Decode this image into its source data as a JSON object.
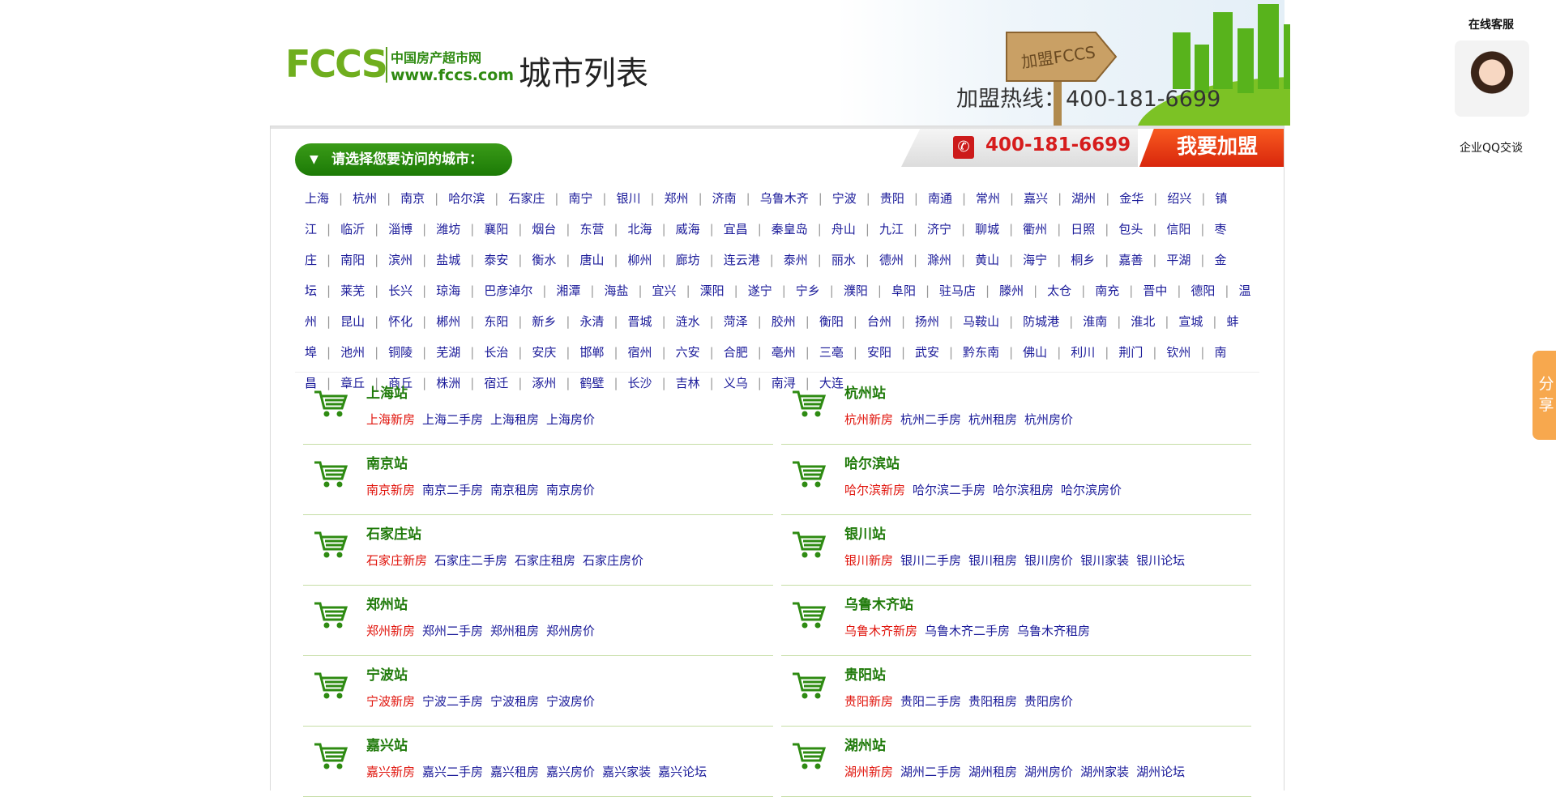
{
  "header": {
    "logo_cn": "中国房产超市网",
    "logo_url": "www.fccs.com",
    "logo_mark": "FCCS",
    "page_title": "城市列表",
    "sign_text": "加盟FCCS",
    "join_hotline": "加盟热线：400-181-6699"
  },
  "panel": {
    "select_prompt": "请选择您要访问的城市：",
    "hotline": "400-181-6699",
    "join_button": "我要加盟"
  },
  "cities": [
    "上海",
    "杭州",
    "南京",
    "哈尔滨",
    "石家庄",
    "南宁",
    "银川",
    "郑州",
    "济南",
    "乌鲁木齐",
    "宁波",
    "贵阳",
    "南通",
    "常州",
    "嘉兴",
    "湖州",
    "金华",
    "绍兴",
    "镇江",
    "临沂",
    "淄博",
    "潍坊",
    "襄阳",
    "烟台",
    "东营",
    "北海",
    "威海",
    "宜昌",
    "秦皇岛",
    "舟山",
    "九江",
    "济宁",
    "聊城",
    "衢州",
    "日照",
    "包头",
    "信阳",
    "枣庄",
    "南阳",
    "滨州",
    "盐城",
    "泰安",
    "衡水",
    "唐山",
    "柳州",
    "廊坊",
    "连云港",
    "泰州",
    "丽水",
    "德州",
    "滁州",
    "黄山",
    "海宁",
    "桐乡",
    "嘉善",
    "平湖",
    "金坛",
    "莱芜",
    "长兴",
    "琼海",
    "巴彦淖尔",
    "湘潭",
    "海盐",
    "宜兴",
    "溧阳",
    "遂宁",
    "宁乡",
    "濮阳",
    "阜阳",
    "驻马店",
    "滕州",
    "太仓",
    "南充",
    "晋中",
    "德阳",
    "温州",
    "昆山",
    "怀化",
    "郴州",
    "东阳",
    "新乡",
    "永清",
    "晋城",
    "涟水",
    "菏泽",
    "胶州",
    "衡阳",
    "台州",
    "扬州",
    "马鞍山",
    "防城港",
    "淮南",
    "淮北",
    "宣城",
    "蚌埠",
    "池州",
    "铜陵",
    "芜湖",
    "长治",
    "安庆",
    "邯郸",
    "宿州",
    "六安",
    "合肥",
    "亳州",
    "三亳",
    "安阳",
    "武安",
    "黔东南",
    "佛山",
    "利川",
    "荆门",
    "钦州",
    "南昌",
    "章丘",
    "商丘",
    "株洲",
    "宿迁",
    "涿州",
    "鹤壁",
    "长沙",
    "吉林",
    "义乌",
    "南浔",
    "大连"
  ],
  "city_lines": [
    {
      "start": 0,
      "end": 20
    },
    {
      "start": 20,
      "end": 42
    },
    {
      "start": 42,
      "end": 62
    },
    {
      "start": 62,
      "end": 84
    },
    {
      "start": 84,
      "end": 105
    },
    {
      "start": 105,
      "end": 125
    }
  ],
  "stations": [
    {
      "title": "上海站",
      "links": [
        "上海新房",
        "上海二手房",
        "上海租房",
        "上海房价"
      ]
    },
    {
      "title": "杭州站",
      "links": [
        "杭州新房",
        "杭州二手房",
        "杭州租房",
        "杭州房价"
      ]
    },
    {
      "title": "南京站",
      "links": [
        "南京新房",
        "南京二手房",
        "南京租房",
        "南京房价"
      ]
    },
    {
      "title": "哈尔滨站",
      "links": [
        "哈尔滨新房",
        "哈尔滨二手房",
        "哈尔滨租房",
        "哈尔滨房价"
      ]
    },
    {
      "title": "石家庄站",
      "links": [
        "石家庄新房",
        "石家庄二手房",
        "石家庄租房",
        "石家庄房价"
      ]
    },
    {
      "title": "银川站",
      "links": [
        "银川新房",
        "银川二手房",
        "银川租房",
        "银川房价",
        "银川家装",
        "银川论坛"
      ]
    },
    {
      "title": "郑州站",
      "links": [
        "郑州新房",
        "郑州二手房",
        "郑州租房",
        "郑州房价"
      ]
    },
    {
      "title": "乌鲁木齐站",
      "links": [
        "乌鲁木齐新房",
        "乌鲁木齐二手房",
        "乌鲁木齐租房"
      ]
    },
    {
      "title": "宁波站",
      "links": [
        "宁波新房",
        "宁波二手房",
        "宁波租房",
        "宁波房价"
      ]
    },
    {
      "title": "贵阳站",
      "links": [
        "贵阳新房",
        "贵阳二手房",
        "贵阳租房",
        "贵阳房价"
      ]
    },
    {
      "title": "嘉兴站",
      "links": [
        "嘉兴新房",
        "嘉兴二手房",
        "嘉兴租房",
        "嘉兴房价",
        "嘉兴家装",
        "嘉兴论坛"
      ]
    },
    {
      "title": "湖州站",
      "links": [
        "湖州新房",
        "湖州二手房",
        "湖州租房",
        "湖州房价",
        "湖州家装",
        "湖州论坛"
      ]
    }
  ],
  "sidebar": {
    "kefu_title": "在线客服",
    "qq_label": "企业QQ交谈",
    "share_label": "分享"
  },
  "colors": {
    "green": "#1f7a0a",
    "link_blue": "#1a1a99",
    "red": "#e0140c",
    "orange": "#f7a84e"
  }
}
